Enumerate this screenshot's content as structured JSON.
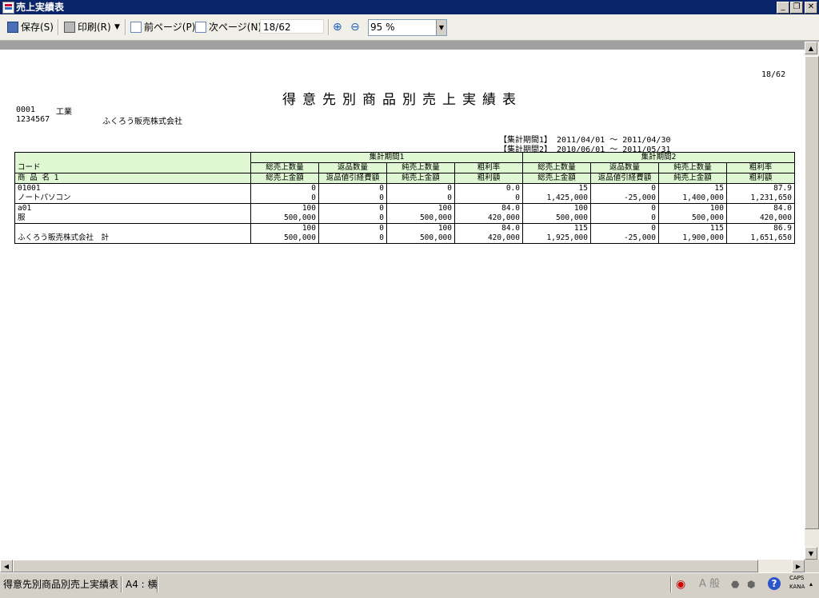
{
  "window": {
    "title": "売上実績表"
  },
  "toolbar": {
    "save_label": "保存(S)",
    "print_label": "印刷(R)",
    "prev_label": "前ページ(P)",
    "next_label": "次ページ(N)",
    "page_value": "18/62",
    "zoom_value": "95 %"
  },
  "report": {
    "page_no": "18/62",
    "title": "得意先別商品別売上実績表",
    "dept_code": "0001",
    "dept_name": "工業",
    "customer_code": "1234567",
    "customer_name": "ふくろう販売株式会社",
    "period1": "【集計期間1】 2011/04/01 ～ 2011/04/30",
    "period2": "【集計期間2】 2010/06/01 ～ 2011/05/31",
    "header": {
      "code": "コード",
      "name": "商 品 名 1",
      "period1": "集計期間1",
      "period2": "集計期間2",
      "row1": [
        "総売上数量",
        "返品数量",
        "純売上数量",
        "粗利率"
      ],
      "row2": [
        "総売上金額",
        "返品値引経費額",
        "純売上金額",
        "粗利額"
      ]
    },
    "rows": [
      {
        "code": "01001",
        "name": "ノートパソコン",
        "p1a": [
          "0",
          "0",
          "0",
          "0.0"
        ],
        "p1b": [
          "0",
          "0",
          "0",
          "0"
        ],
        "p2a": [
          "15",
          "0",
          "15",
          "87.9"
        ],
        "p2b": [
          "1,425,000",
          "-25,000",
          "1,400,000",
          "1,231,650"
        ]
      },
      {
        "code": "a01",
        "name": "服",
        "p1a": [
          "100",
          "0",
          "100",
          "84.0"
        ],
        "p1b": [
          "500,000",
          "0",
          "500,000",
          "420,000"
        ],
        "p2a": [
          "100",
          "0",
          "100",
          "84.0"
        ],
        "p2b": [
          "500,000",
          "0",
          "500,000",
          "420,000"
        ]
      },
      {
        "code": "",
        "name": "ふくろう販売株式会社　計",
        "p1a": [
          "100",
          "0",
          "100",
          "84.0"
        ],
        "p1b": [
          "500,000",
          "0",
          "500,000",
          "420,000"
        ],
        "p2a": [
          "115",
          "0",
          "115",
          "86.9"
        ],
        "p2b": [
          "1,925,000",
          "-25,000",
          "1,900,000",
          "1,651,650"
        ]
      }
    ]
  },
  "status": {
    "report_name": "得意先別商品別売上実績表",
    "paper": "A4 : 横",
    "caps": "CAPS",
    "kana": "KANA",
    "ime_mode": "A 般"
  }
}
